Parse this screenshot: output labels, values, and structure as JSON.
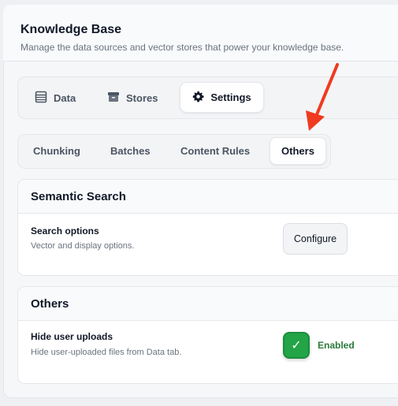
{
  "header": {
    "title": "Knowledge Base",
    "subtitle": "Manage the data sources and vector stores that power your knowledge base."
  },
  "main_tabs": [
    {
      "label": "Data",
      "icon": "table-icon",
      "active": false
    },
    {
      "label": "Stores",
      "icon": "box-icon",
      "active": false
    },
    {
      "label": "Settings",
      "icon": "gear-icon",
      "active": true
    }
  ],
  "sub_tabs": [
    {
      "label": "Chunking",
      "active": false
    },
    {
      "label": "Batches",
      "active": false
    },
    {
      "label": "Content Rules",
      "active": false
    },
    {
      "label": "Others",
      "active": true
    }
  ],
  "cards": {
    "semantic": {
      "title": "Semantic Search",
      "row_label": "Search options",
      "row_desc": "Vector and display options.",
      "button": "Configure"
    },
    "others": {
      "title": "Others",
      "row_label": "Hide user uploads",
      "row_desc": "Hide user-uploaded files from Data tab.",
      "toggle_state": "Enabled",
      "toggle_on": true
    }
  },
  "colors": {
    "accent_green": "#22a447",
    "enabled_text": "#2a7a3b",
    "annotation_arrow": "#ef3b1f"
  }
}
